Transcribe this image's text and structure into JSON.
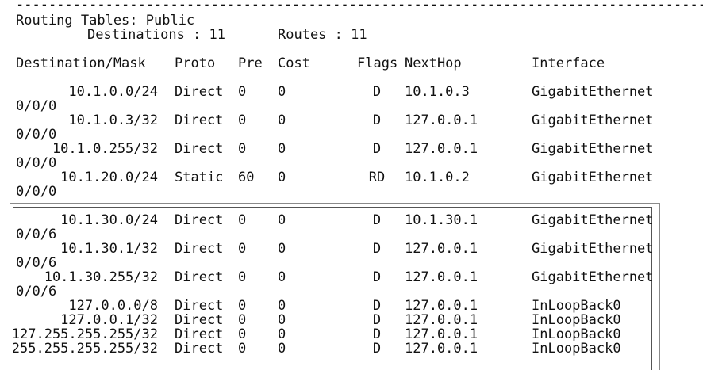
{
  "terminal": {
    "separator": "--------------------------------------------------------------------------------------",
    "title": "Routing Tables: Public",
    "destinations_label": "Destinations : 11",
    "routes_label": "Routes : 11"
  },
  "headers": {
    "destination": "Destination/Mask",
    "proto": "Proto",
    "pre": "Pre",
    "cost": "Cost",
    "flags": "Flags",
    "nexthop": "NextHop",
    "interface": "Interface"
  },
  "routes": [
    {
      "destination": "10.1.0.0/24",
      "proto": "Direct",
      "pre": "0",
      "cost": "0",
      "flags": "D",
      "nexthop": "10.1.0.3",
      "interface": "GigabitEthernet",
      "interface_cont": "0/0/0"
    },
    {
      "destination": "10.1.0.3/32",
      "proto": "Direct",
      "pre": "0",
      "cost": "0",
      "flags": "D",
      "nexthop": "127.0.0.1",
      "interface": "GigabitEthernet",
      "interface_cont": "0/0/0"
    },
    {
      "destination": "10.1.0.255/32",
      "proto": "Direct",
      "pre": "0",
      "cost": "0",
      "flags": "D",
      "nexthop": "127.0.0.1",
      "interface": "GigabitEthernet",
      "interface_cont": "0/0/0"
    },
    {
      "destination": "10.1.20.0/24",
      "proto": "Static",
      "pre": "60",
      "cost": "0",
      "flags": "RD",
      "nexthop": "10.1.0.2",
      "interface": "GigabitEthernet",
      "interface_cont": "0/0/0"
    },
    {
      "destination": "10.1.30.0/24",
      "proto": "Direct",
      "pre": "0",
      "cost": "0",
      "flags": "D",
      "nexthop": "10.1.30.1",
      "interface": "GigabitEthernet",
      "interface_cont": "0/0/6"
    },
    {
      "destination": "10.1.30.1/32",
      "proto": "Direct",
      "pre": "0",
      "cost": "0",
      "flags": "D",
      "nexthop": "127.0.0.1",
      "interface": "GigabitEthernet",
      "interface_cont": "0/0/6"
    },
    {
      "destination": "10.1.30.255/32",
      "proto": "Direct",
      "pre": "0",
      "cost": "0",
      "flags": "D",
      "nexthop": "127.0.0.1",
      "interface": "GigabitEthernet",
      "interface_cont": "0/0/6"
    },
    {
      "destination": "127.0.0.0/8",
      "proto": "Direct",
      "pre": "0",
      "cost": "0",
      "flags": "D",
      "nexthop": "127.0.0.1",
      "interface": "InLoopBack0"
    },
    {
      "destination": "127.0.0.1/32",
      "proto": "Direct",
      "pre": "0",
      "cost": "0",
      "flags": "D",
      "nexthop": "127.0.0.1",
      "interface": "InLoopBack0"
    },
    {
      "destination": "127.255.255.255/32",
      "proto": "Direct",
      "pre": "0",
      "cost": "0",
      "flags": "D",
      "nexthop": "127.0.0.1",
      "interface": "InLoopBack0"
    },
    {
      "destination": "255.255.255.255/32",
      "proto": "Direct",
      "pre": "0",
      "cost": "0",
      "flags": "D",
      "nexthop": "127.0.0.1",
      "interface": "InLoopBack0"
    }
  ]
}
